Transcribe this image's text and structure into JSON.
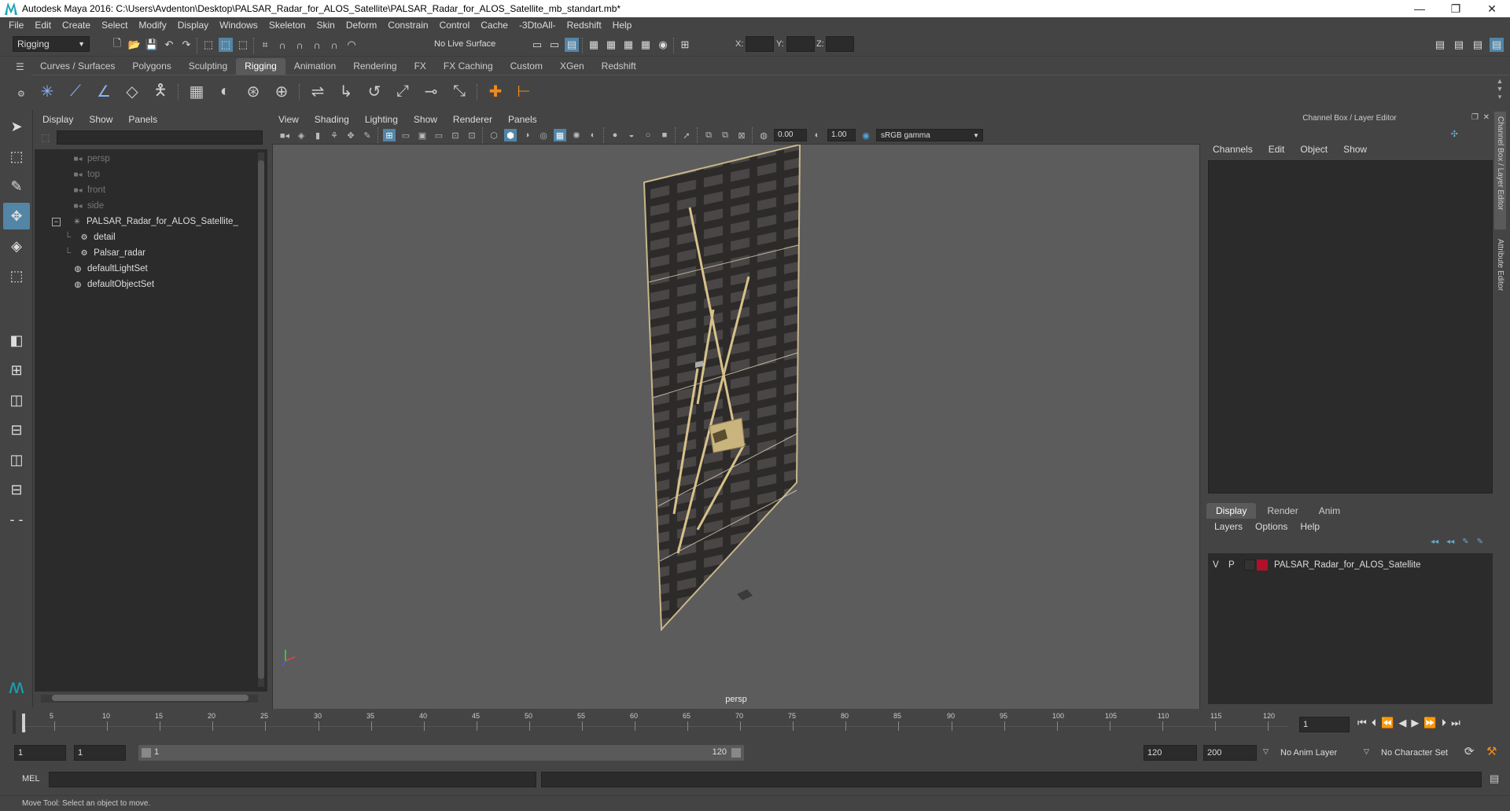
{
  "window": {
    "title": "Autodesk Maya 2016: C:\\Users\\Avdenton\\Desktop\\PALSAR_Radar_for_ALOS_Satellite\\PALSAR_Radar_for_ALOS_Satellite_mb_standart.mb*",
    "controls": {
      "minimize": "—",
      "maximize": "❐",
      "close": "✕"
    }
  },
  "menubar": [
    "File",
    "Edit",
    "Create",
    "Select",
    "Modify",
    "Display",
    "Windows",
    "Skeleton",
    "Skin",
    "Deform",
    "Constrain",
    "Control",
    "Cache",
    "-3DtoAll-",
    "Redshift",
    "Help"
  ],
  "statusline": {
    "mode": "Rigging",
    "live_surface": "No Live Surface",
    "x_label": "X:",
    "y_label": "Y:",
    "z_label": "Z:"
  },
  "shelf": {
    "tabs": [
      "Curves / Surfaces",
      "Polygons",
      "Sculpting",
      "Rigging",
      "Animation",
      "Rendering",
      "FX",
      "FX Caching",
      "Custom",
      "XGen",
      "Redshift"
    ],
    "active_tab": "Rigging"
  },
  "outliner": {
    "menu": [
      "Display",
      "Show",
      "Panels"
    ],
    "items": [
      {
        "label": "persp",
        "type": "camera",
        "dim": true
      },
      {
        "label": "top",
        "type": "camera",
        "dim": true
      },
      {
        "label": "front",
        "type": "camera",
        "dim": true
      },
      {
        "label": "side",
        "type": "camera",
        "dim": true
      },
      {
        "label": "PALSAR_Radar_for_ALOS_Satellite_",
        "type": "group",
        "dim": false
      },
      {
        "label": "detail",
        "type": "mesh",
        "dim": false
      },
      {
        "label": "Palsar_radar",
        "type": "mesh",
        "dim": false
      },
      {
        "label": "defaultLightSet",
        "type": "set",
        "dim": false
      },
      {
        "label": "defaultObjectSet",
        "type": "set",
        "dim": false
      }
    ]
  },
  "viewport": {
    "menu": [
      "View",
      "Shading",
      "Lighting",
      "Show",
      "Renderer",
      "Panels"
    ],
    "exposure": "0.00",
    "gamma": "1.00",
    "colorspace": "sRGB gamma",
    "camera_label": "persp"
  },
  "channelbox": {
    "title": "Channel Box / Layer Editor",
    "menu": [
      "Channels",
      "Edit",
      "Object",
      "Show"
    ]
  },
  "layereditor": {
    "tabs": [
      "Display",
      "Render",
      "Anim"
    ],
    "active_tab": "Display",
    "menu": [
      "Layers",
      "Options",
      "Help"
    ],
    "layer": {
      "v": "V",
      "p": "P",
      "name": "PALSAR_Radar_for_ALOS_Satellite",
      "color": "#b0102a"
    }
  },
  "side_tabs": [
    "Channel Box / Layer Editor",
    "Attribute Editor"
  ],
  "timeline": {
    "ticks": [
      "5",
      "10",
      "15",
      "20",
      "25",
      "30",
      "35",
      "40",
      "45",
      "50",
      "55",
      "60",
      "65",
      "70",
      "75",
      "80",
      "85",
      "90",
      "95",
      "100",
      "105",
      "110",
      "115",
      "120"
    ],
    "start_tick": "1",
    "current_frame": "1"
  },
  "range": {
    "start": "1",
    "playback_start": "1",
    "slider_start": "1",
    "slider_end": "120",
    "playback_end": "120",
    "end": "200",
    "anim_layer": "No Anim Layer",
    "character_set": "No Character Set"
  },
  "cmdline": {
    "label": "MEL"
  },
  "helpline": {
    "text": "Move Tool: Select an object to move."
  }
}
